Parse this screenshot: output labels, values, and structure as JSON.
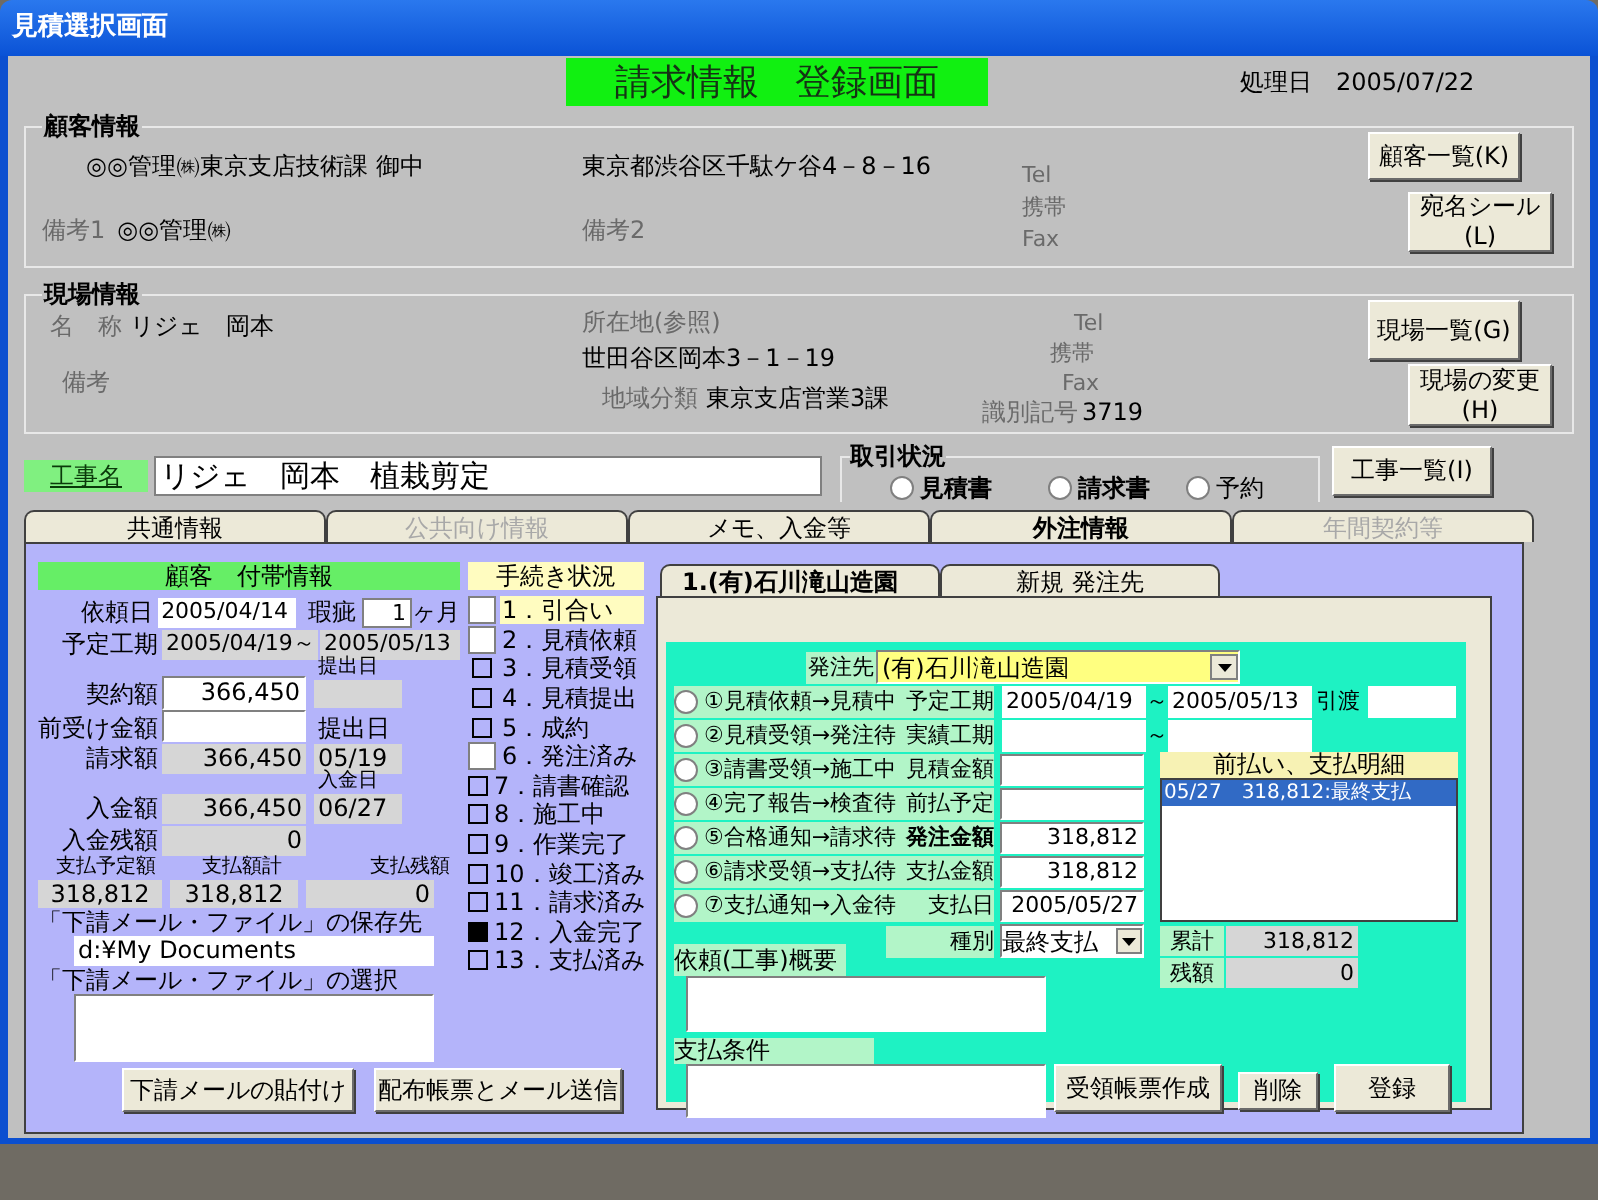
{
  "window": {
    "title": "見積選択画面"
  },
  "header": {
    "title": "請求情報　登録画面",
    "date_label": "処理日",
    "date": "2005/07/22"
  },
  "customer": {
    "legend": "顧客情報",
    "name": "◎◎管理㈱東京支店技術課 御中",
    "address": "東京都渋谷区千駄ケ谷4－8－16",
    "tel_label": "Tel",
    "mobile_label": "携帯",
    "fax_label": "Fax",
    "note1_label": "備考1",
    "note1": "◎◎管理㈱",
    "note2_label": "備考2",
    "buttons": [
      [
        "顧客一覧(K)"
      ],
      [
        "宛名シール",
        "(L)"
      ]
    ]
  },
  "site": {
    "legend": "現場情報",
    "name_label": "名　称",
    "name": "リジェ　岡本",
    "note_label": "備考",
    "address_label": "所在地(参照)",
    "address": "世田谷区岡本3－1－19",
    "tel_label": "Tel",
    "mobile_label": "携帯",
    "fax_label": "Fax",
    "region_label": "地域分類",
    "region": "東京支店営業3課",
    "code_label": "識別記号",
    "code": "3719",
    "buttons": [
      [
        "現場一覧(G)"
      ],
      [
        "現場の変更",
        "(H)"
      ]
    ]
  },
  "work": {
    "label": "工事名",
    "value": "リジェ　岡本　植栽剪定",
    "button": "工事一覧(I)"
  },
  "deal_status": {
    "legend": "取引状況",
    "options": [
      {
        "label": "見積書",
        "selected": false
      },
      {
        "label": "請求書",
        "selected": false
      },
      {
        "label": "予約",
        "selected": false
      }
    ]
  },
  "tabs": [
    {
      "label": "共通情報",
      "selected": false,
      "disabled": false
    },
    {
      "label": "公共向け情報",
      "selected": false,
      "disabled": true
    },
    {
      "label": "メモ、入金等",
      "selected": false,
      "disabled": false
    },
    {
      "label": "外注情報",
      "selected": true,
      "disabled": false
    },
    {
      "label": "年間契約等",
      "selected": false,
      "disabled": true
    }
  ],
  "customer_extra": {
    "title": "顧客　付帯情報",
    "request_date_label": "依頼日",
    "request_date": "2005/04/14",
    "warranty_label": "瑕疵",
    "warranty_value": "1",
    "warranty_unit": "ヶ月",
    "schedule_label": "予定工期",
    "schedule_from": "2005/04/19～",
    "schedule_to": "2005/05/13",
    "contract_submit_label": "提出日",
    "contract_label": "契約額",
    "contract": "366,450",
    "advance_label": "前受け金額",
    "invoice_submit_label": "提出日",
    "invoice_label": "請求額",
    "invoice": "366,450",
    "invoice_date": "05/19",
    "paid_date_label": "入金日",
    "paid_label": "入金額",
    "paid": "366,450",
    "paid_date": "06/27",
    "balance_label": "入金残額",
    "balance": "0",
    "pay_plan_label": "支払予定額",
    "pay_plan": "318,812",
    "pay_total_label": "支払額計",
    "pay_total": "318,812",
    "pay_remain_label": "支払残額",
    "pay_remain": "0",
    "save_label": "「下請メール・ファイル」の保存先",
    "save_path": "d:¥My Documents",
    "select_label": "「下請メール・ファイル」の選択",
    "buttons": [
      "下請メールの貼付け",
      "配布帳票とメール送信"
    ]
  },
  "procedure": {
    "title": "手続き状況",
    "items": [
      {
        "label": "1．引合い",
        "kind": "box",
        "checked": false,
        "selected": true
      },
      {
        "label": "2．見積依頼",
        "kind": "box",
        "checked": false,
        "selected": false
      },
      {
        "label": "3．見積受領",
        "kind": "mark",
        "checked": false,
        "selected": false
      },
      {
        "label": "4．見積提出",
        "kind": "mark",
        "checked": false,
        "selected": false
      },
      {
        "label": "5．成約",
        "kind": "mark",
        "checked": false,
        "selected": false
      },
      {
        "label": "6．発注済み",
        "kind": "box",
        "checked": false,
        "selected": false
      },
      {
        "label": "7．請書確認",
        "kind": "mark",
        "checked": false,
        "selected": false
      },
      {
        "label": "8．施工中",
        "kind": "mark",
        "checked": false,
        "selected": false
      },
      {
        "label": "9．作業完了",
        "kind": "mark",
        "checked": false,
        "selected": false
      },
      {
        "label": "10．竣工済み",
        "kind": "mark",
        "checked": false,
        "selected": false
      },
      {
        "label": "11．請求済み",
        "kind": "mark",
        "checked": false,
        "selected": false
      },
      {
        "label": "12．入金完了",
        "kind": "mark",
        "checked": true,
        "selected": false
      },
      {
        "label": "13．支払済み",
        "kind": "mark",
        "checked": false,
        "selected": false
      }
    ]
  },
  "vendor_tabs": [
    {
      "label": "1.(有)石川滝山造園",
      "selected": true
    },
    {
      "label": "新規 発注先",
      "selected": false
    }
  ],
  "order": {
    "vendor_label": "発注先",
    "vendor": "(有)石川滝山造園",
    "period_rows": [
      {
        "stage": "①見積依頼→見積中",
        "selected": false,
        "label": "予定工期",
        "from": "2005/04/19",
        "separator": "～",
        "to": "2005/05/13",
        "extra_label": "引渡"
      },
      {
        "stage": "②見積受領→発注待",
        "selected": false,
        "label": "実績工期",
        "separator": "～"
      }
    ],
    "amount_rows": [
      {
        "stage": "③請書受領→施工中",
        "selected": false,
        "label": "見積金額",
        "bold": false
      },
      {
        "stage": "④完了報告→検査待",
        "selected": false,
        "label": "前払予定",
        "bold": false
      },
      {
        "stage": "⑤合格通知→請求待",
        "selected": false,
        "label": "発注金額",
        "bold": true,
        "value": "318,812"
      },
      {
        "stage": "⑥請求受領→支払待",
        "selected": false,
        "label": "支払金額",
        "bold": false,
        "value": "318,812"
      },
      {
        "stage": "⑦支払通知→入金待",
        "selected": false,
        "label": "支払日",
        "bold": false,
        "value": "2005/05/27"
      }
    ],
    "type_label": "種別",
    "type": "最終支払",
    "payments_title": "前払い、支払明細",
    "payments": [
      {
        "text": "05/27　318,812:最終支払",
        "selected": true
      }
    ],
    "total_label": "累計",
    "total": "318,812",
    "remain_label": "残額",
    "remain": "0",
    "summary_label": "依頼(工事)概要",
    "terms_label": "支払条件",
    "buttons": [
      "受領帳票作成",
      "削除",
      "登録"
    ]
  }
}
